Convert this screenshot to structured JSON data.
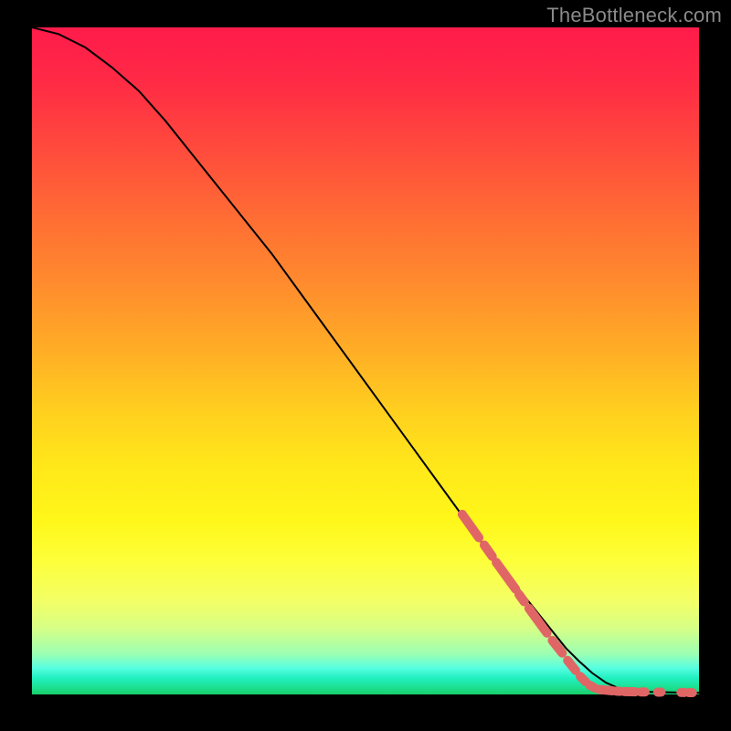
{
  "attribution": "TheBottleneck.com",
  "colors": {
    "marker": "#e06666",
    "curve": "#000000"
  },
  "chart_data": {
    "type": "line",
    "title": "",
    "xlabel": "",
    "ylabel": "",
    "xlim": [
      0,
      100
    ],
    "ylim": [
      0,
      100
    ],
    "grid": false,
    "legend": false,
    "series": [
      {
        "name": "curve",
        "x": [
          0,
          4,
          8,
          12,
          16,
          20,
          24,
          28,
          32,
          36,
          40,
          44,
          48,
          52,
          56,
          60,
          64,
          68,
          72,
          76,
          80,
          82,
          84,
          86,
          88,
          90,
          92,
          94,
          96,
          98,
          100
        ],
        "y": [
          100,
          99,
          97,
          94,
          90.5,
          86,
          81,
          76,
          71,
          66,
          60.5,
          55,
          49.5,
          44,
          38.5,
          33,
          27.5,
          22,
          17,
          12,
          7,
          5,
          3.2,
          1.8,
          0.9,
          0.5,
          0.4,
          0.35,
          0.3,
          0.28,
          0.25
        ]
      }
    ],
    "highlight_segments": [
      {
        "x0": 64.5,
        "y0": 27.0,
        "x1": 67.0,
        "y1": 23.5
      },
      {
        "x0": 67.8,
        "y0": 22.4,
        "x1": 69.0,
        "y1": 20.7
      },
      {
        "x0": 69.6,
        "y0": 19.8,
        "x1": 72.5,
        "y1": 15.8
      },
      {
        "x0": 73.0,
        "y0": 15.0,
        "x1": 73.8,
        "y1": 13.9
      },
      {
        "x0": 74.5,
        "y0": 12.9,
        "x1": 77.2,
        "y1": 9.2
      },
      {
        "x0": 78.0,
        "y0": 8.1,
        "x1": 79.5,
        "y1": 6.2
      },
      {
        "x0": 80.3,
        "y0": 5.1,
        "x1": 81.5,
        "y1": 3.6
      },
      {
        "x0": 82.2,
        "y0": 2.7,
        "x1": 83.0,
        "y1": 1.9
      },
      {
        "x0": 83.6,
        "y0": 1.4,
        "x1": 84.3,
        "y1": 1.0
      },
      {
        "x0": 85.0,
        "y0": 0.75,
        "x1": 87.0,
        "y1": 0.55
      },
      {
        "x0": 87.6,
        "y0": 0.5,
        "x1": 88.2,
        "y1": 0.46
      },
      {
        "x0": 88.8,
        "y0": 0.43,
        "x1": 90.5,
        "y1": 0.4
      },
      {
        "x0": 91.3,
        "y0": 0.38,
        "x1": 91.9,
        "y1": 0.37
      },
      {
        "x0": 93.8,
        "y0": 0.35,
        "x1": 94.3,
        "y1": 0.34
      },
      {
        "x0": 97.3,
        "y0": 0.3,
        "x1": 97.8,
        "y1": 0.29
      },
      {
        "x0": 98.5,
        "y0": 0.28,
        "x1": 99.0,
        "y1": 0.27
      }
    ]
  }
}
